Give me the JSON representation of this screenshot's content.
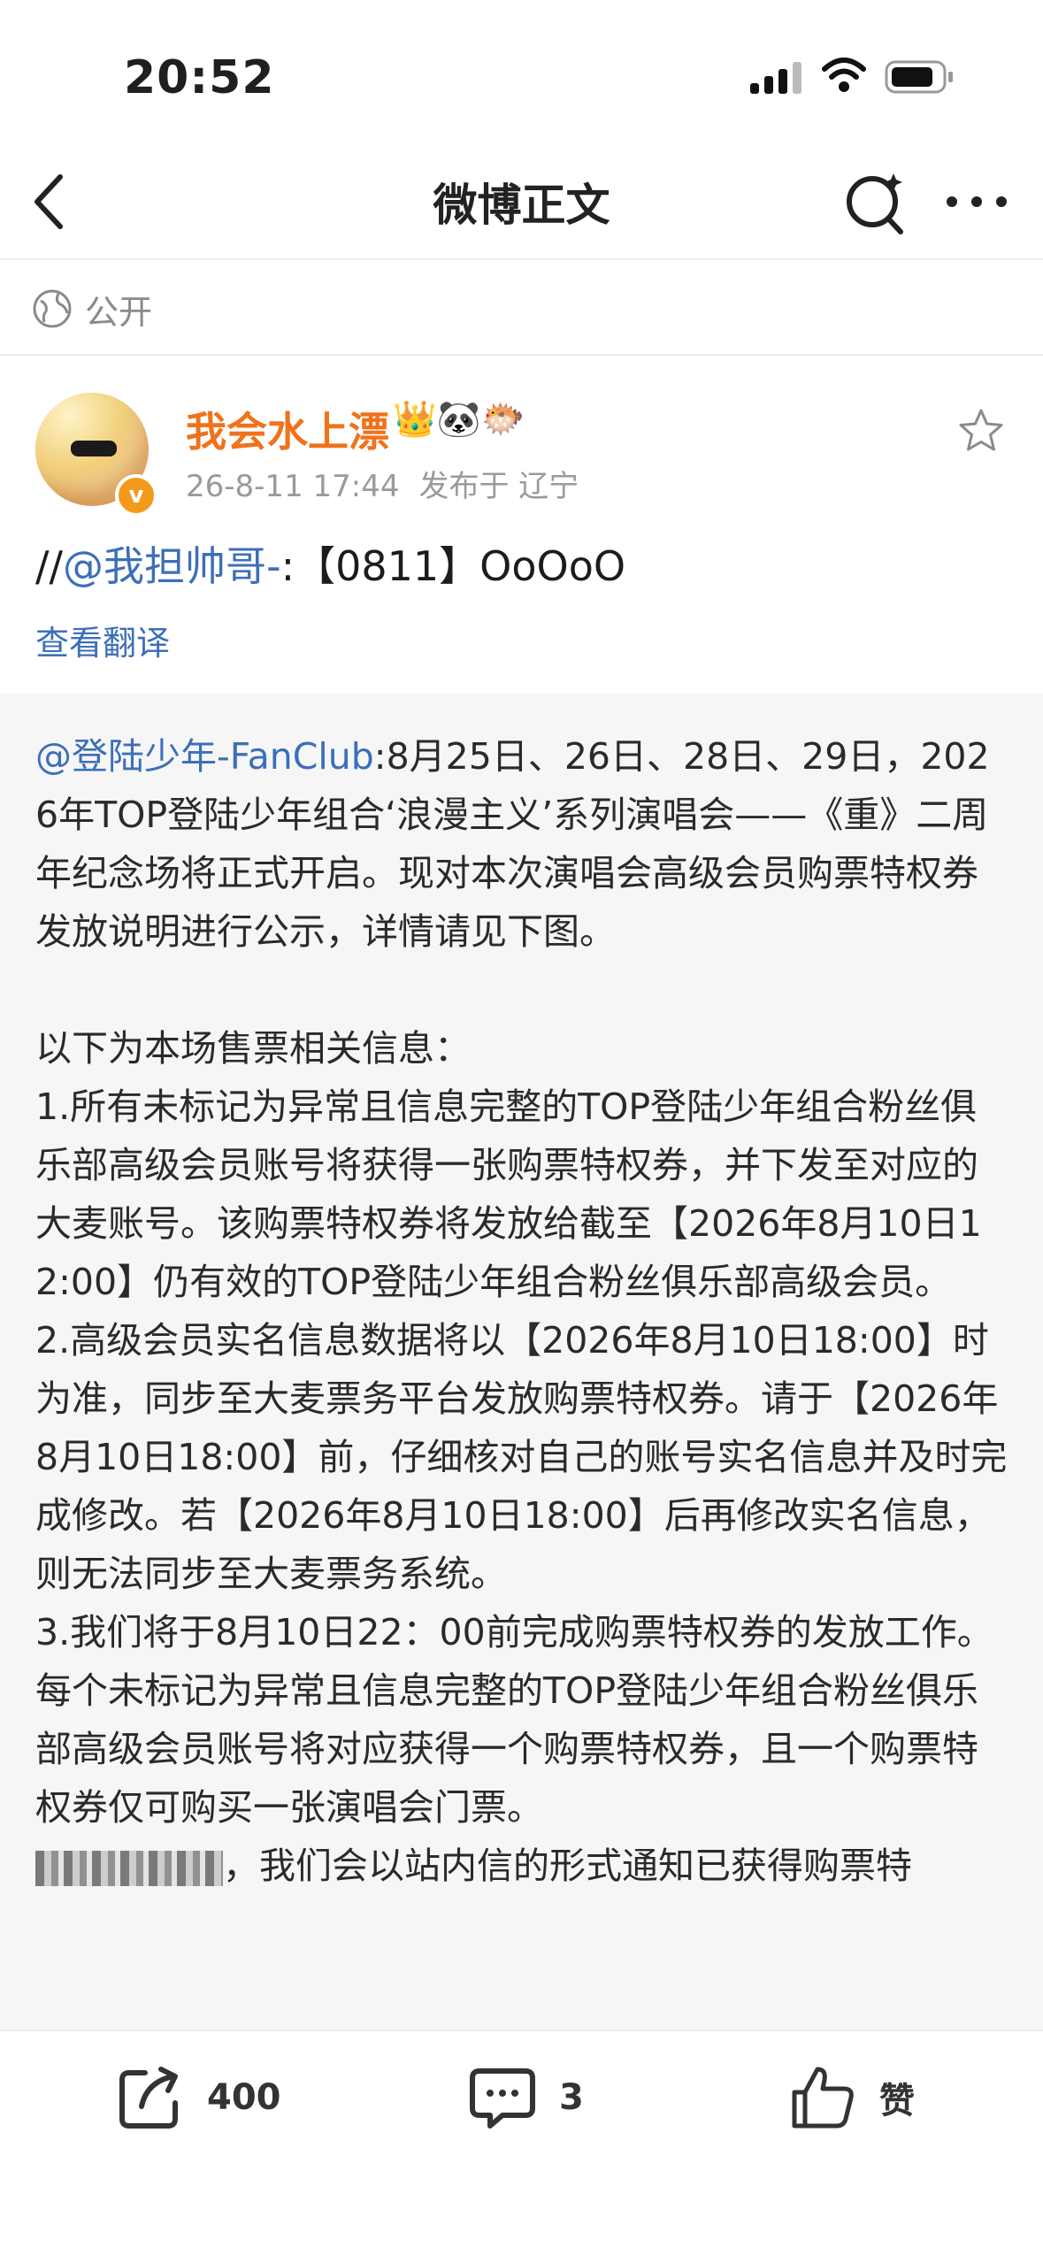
{
  "status": {
    "time": "20:52"
  },
  "nav": {
    "title": "微博正文"
  },
  "visibility": {
    "label": "公开"
  },
  "post": {
    "author": "我会水上漂",
    "verified_badge": "v",
    "emojis": "👑🐼🐡",
    "timestamp": "26-8-11 17:44",
    "source": "发布于 辽宁",
    "text_prefix": "//",
    "mention": "@我担帅哥-",
    "text_suffix": ":【0811】OoOoO",
    "translate_label": "查看翻译"
  },
  "repost": {
    "mention": "@登陆少年-FanClub",
    "body": ":8月25日、26日、28日、29日，2026年TOP登陆少年组合‘浪漫主义’系列演唱会——《重》二周年纪念场将正式开启。现对本次演唱会高级会员购票特权券发放说明进行公示，详情请见下图。\n\n以下为本场售票相关信息：\n1.所有未标记为异常且信息完整的TOP登陆少年组合粉丝俱乐部高级会员账号将获得一张购票特权券，并下发至对应的大麦账号。该购票特权券将发放给截至【2026年8月10日12:00】仍有效的TOP登陆少年组合粉丝俱乐部高级会员。\n2.高级会员实名信息数据将以【2026年8月10日18:00】时为准，同步至大麦票务平台发放购票特权券。请于【2026年8月10日18:00】前，仔细核对自己的账号实名信息并及时完成修改。若【2026年8月10日18:00】后再修改实名信息，则无法同步至大麦票务系统。\n3.我们将于8月10日22：00前完成购票特权券的发放工作。每个未标记为异常且信息完整的TOP登陆少年组合粉丝俱乐部高级会员账号将对应获得一个购票特权券，且一个购票特权券仅可购买一张演唱会门票。",
    "last_line": "，我们会以站内信的形式通知已获得购票特"
  },
  "toolbar": {
    "repost_count": "400",
    "comment_count": "3",
    "like_label": "赞"
  },
  "icons": [
    "back-icon",
    "search-icon",
    "more-icon",
    "globe-icon",
    "star-icon",
    "repost-icon",
    "comment-icon",
    "like-icon",
    "signal-icon",
    "wifi-icon",
    "battery-icon"
  ],
  "colors": {
    "accent_blue": "#3d6fb8",
    "author_orange": "#f0721b",
    "badge_orange": "#f39a1d"
  }
}
